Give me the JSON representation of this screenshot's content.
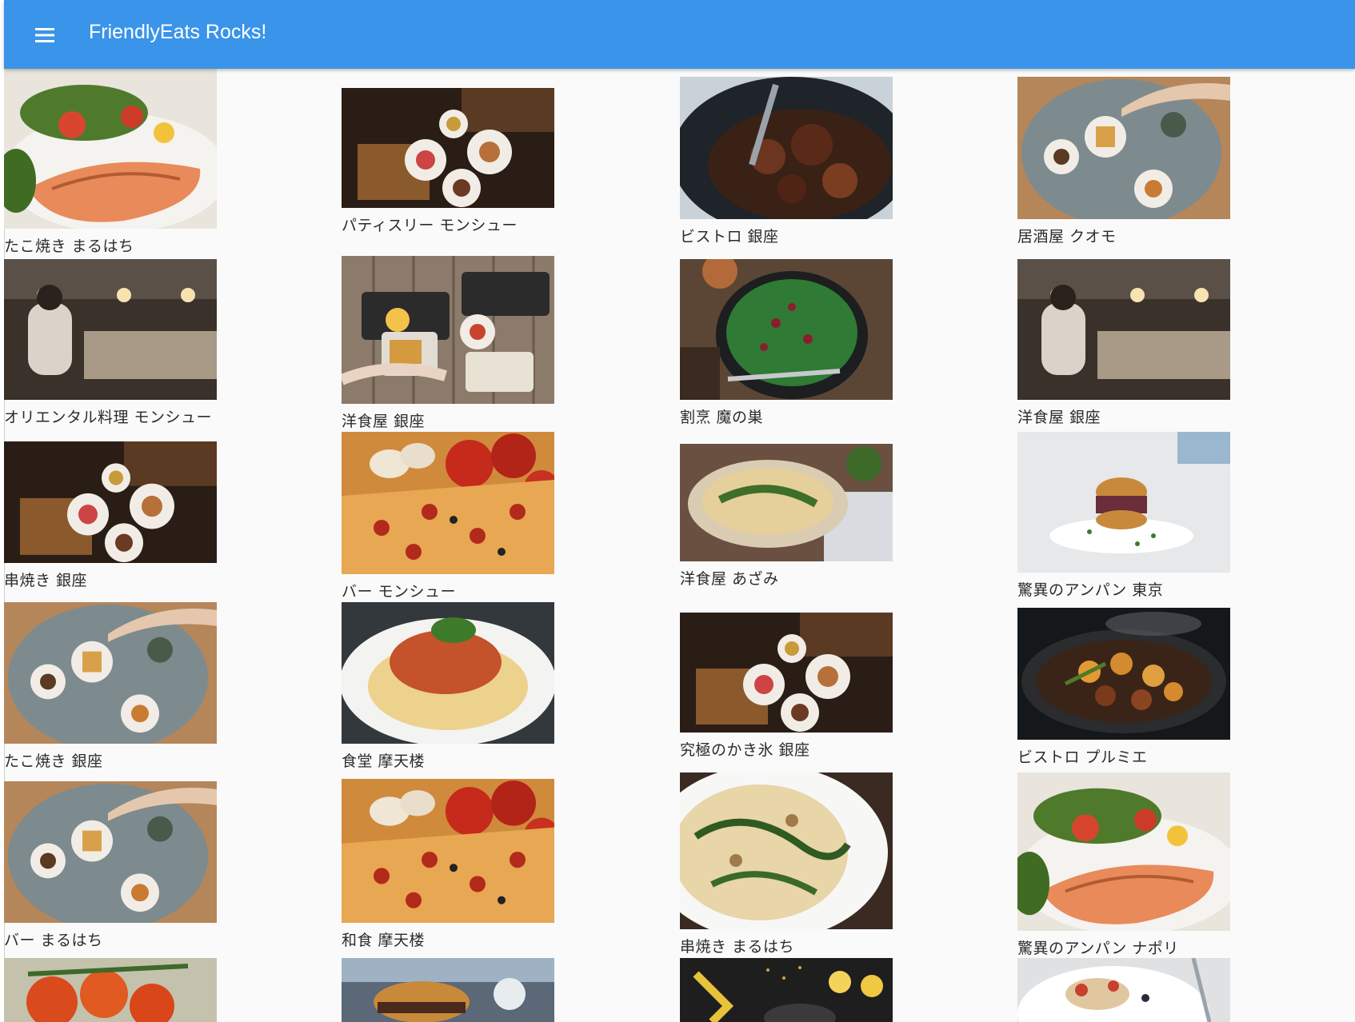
{
  "app_bar": {
    "title": "FriendlyEats Rocks!",
    "menu_icon": "menu-icon"
  },
  "restaurants": [
    {
      "name": "たこ焼き まるはち",
      "photo": "grilled-salmon-salad"
    },
    {
      "name": "パティスリー モンシュー",
      "photo": "table-overhead-plates"
    },
    {
      "name": "ビストロ 銀座",
      "photo": "braised-meat-pan"
    },
    {
      "name": "居酒屋 クオモ",
      "photo": "shared-table-waffles"
    },
    {
      "name": "オリエンタル料理 モンシュー",
      "photo": "restaurant-kitchen-chef"
    },
    {
      "name": "洋食屋 銀座",
      "photo": "fries-and-dips-wood-table"
    },
    {
      "name": "割烹 魔の巣",
      "photo": "green-salad-bowl"
    },
    {
      "name": "洋食屋 銀座",
      "photo": "restaurant-kitchen-chef"
    },
    {
      "name": "串焼き 銀座",
      "photo": "table-overhead-plates"
    },
    {
      "name": "バー モンシュー",
      "photo": "pepperoni-pizza-tomatoes"
    },
    {
      "name": "洋食屋 あざみ",
      "photo": "pasta-bowl"
    },
    {
      "name": "驚異のアンパン 東京",
      "photo": "burger-white-plate"
    },
    {
      "name": "たこ焼き 銀座",
      "photo": "shared-table-waffles"
    },
    {
      "name": "食堂 摩天楼",
      "photo": "spaghetti-bolognese"
    },
    {
      "name": "究極のかき氷 銀座",
      "photo": "table-overhead-plates"
    },
    {
      "name": "ビストロ プルミエ",
      "photo": "roasted-vegetables-skillet"
    },
    {
      "name": "バー まるはち",
      "photo": "shared-table-waffles"
    },
    {
      "name": "和食 摩天楼",
      "photo": "pepperoni-pizza-tomatoes"
    },
    {
      "name": "串焼き まるはち",
      "photo": "pappardelle-white-plate"
    },
    {
      "name": "驚異のアンパン ナポリ",
      "photo": "grilled-salmon-salad"
    },
    {
      "name": "",
      "photo": "tomatoes-on-vine"
    },
    {
      "name": "",
      "photo": "burger-close-up"
    },
    {
      "name": "",
      "photo": "lemons-and-flowers-dark"
    },
    {
      "name": "",
      "photo": "dessert-plate"
    }
  ]
}
